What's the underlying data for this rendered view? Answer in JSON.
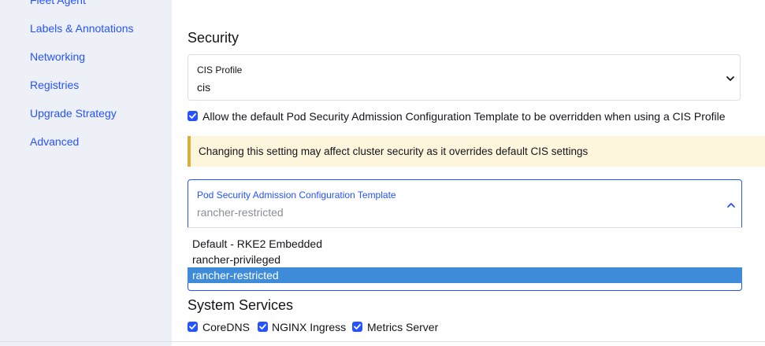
{
  "sidebar": {
    "items": [
      {
        "label": "Fleet Agent"
      },
      {
        "label": "Labels & Annotations"
      },
      {
        "label": "Networking"
      },
      {
        "label": "Registries"
      },
      {
        "label": "Upgrade Strategy"
      },
      {
        "label": "Advanced"
      }
    ]
  },
  "security": {
    "title": "Security",
    "cis_profile": {
      "label": "CIS Profile",
      "value": "cis"
    },
    "allow_override": {
      "checked": true,
      "label": "Allow the default Pod Security Admission Configuration Template to be overridden when using a CIS Profile"
    },
    "warning": "Changing this setting may affect cluster security as it overrides default CIS settings",
    "psa_template": {
      "label": "Pod Security Admission Configuration Template",
      "value": "rancher-restricted",
      "options": [
        "Default - RKE2 Embedded",
        "rancher-privileged",
        "rancher-restricted"
      ],
      "selected_option": "rancher-restricted"
    }
  },
  "system_services": {
    "title": "System Services",
    "items": [
      {
        "label": "CoreDNS",
        "checked": true
      },
      {
        "label": "NGINX Ingress",
        "checked": true
      },
      {
        "label": "Metrics Server",
        "checked": true
      }
    ]
  },
  "colors": {
    "accent": "#2453ff",
    "sidebar_bg": "#eef0f8",
    "warning_bg": "#fdf5dc",
    "warning_border": "#d9b03d",
    "selected_option_bg": "#3d8bd9"
  }
}
